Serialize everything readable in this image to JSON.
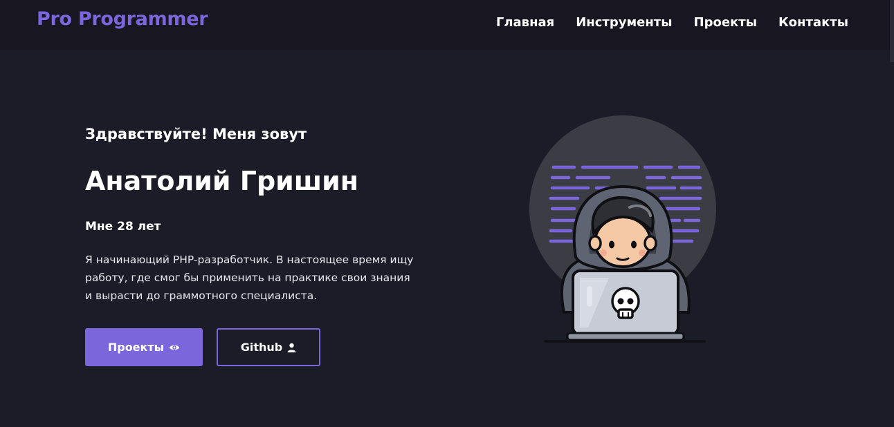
{
  "header": {
    "logo": "Pro Programmer",
    "nav": [
      "Главная",
      "Инструменты",
      "Проекты",
      "Контакты"
    ]
  },
  "hero": {
    "greeting": "Здравствуйте! Меня зовут",
    "name": "Анатолий Гришин",
    "age": "Мне 28 лет",
    "about": "Я начинающий PHP-разработчик. В настоящее время ищу работу, где смог бы применить на практике свои знания и вырасти до граммотного специалиста.",
    "buttons": {
      "projects_label": "Проекты",
      "projects_icon": "eye-icon",
      "github_label": "Github",
      "github_icon": "user-icon"
    }
  },
  "colors": {
    "accent": "#7c66dc",
    "background": "#1c1b28",
    "header_bg": "#171621"
  }
}
